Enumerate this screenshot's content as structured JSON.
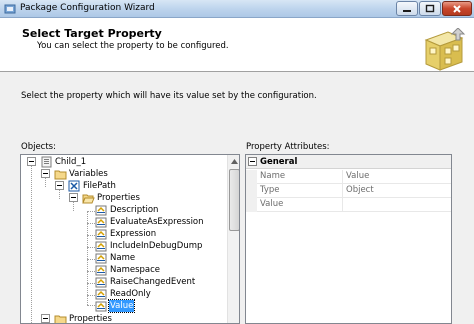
{
  "window": {
    "title": "Package Configuration Wizard"
  },
  "header": {
    "title": "Select Target Property",
    "subtitle": "You can select the property to be configured."
  },
  "instruction": "Select the property which will have its value set by the configuration.",
  "objects_label": "Objects:",
  "attributes_label": "Property Attributes:",
  "tree": {
    "child": "Child_1",
    "variables": "Variables",
    "filepath": "FilePath",
    "properties": "Properties",
    "props": [
      "Description",
      "EvaluateAsExpression",
      "Expression",
      "IncludeInDebugDump",
      "Name",
      "Namespace",
      "RaiseChangedEvent",
      "ReadOnly",
      "Value"
    ],
    "selected": "Value",
    "properties_bottom": "Properties"
  },
  "property_grid": {
    "category": "General",
    "rows": [
      {
        "name": "Name",
        "value": "Value"
      },
      {
        "name": "Type",
        "value": "Object"
      },
      {
        "name": "Value",
        "value": ""
      }
    ]
  }
}
